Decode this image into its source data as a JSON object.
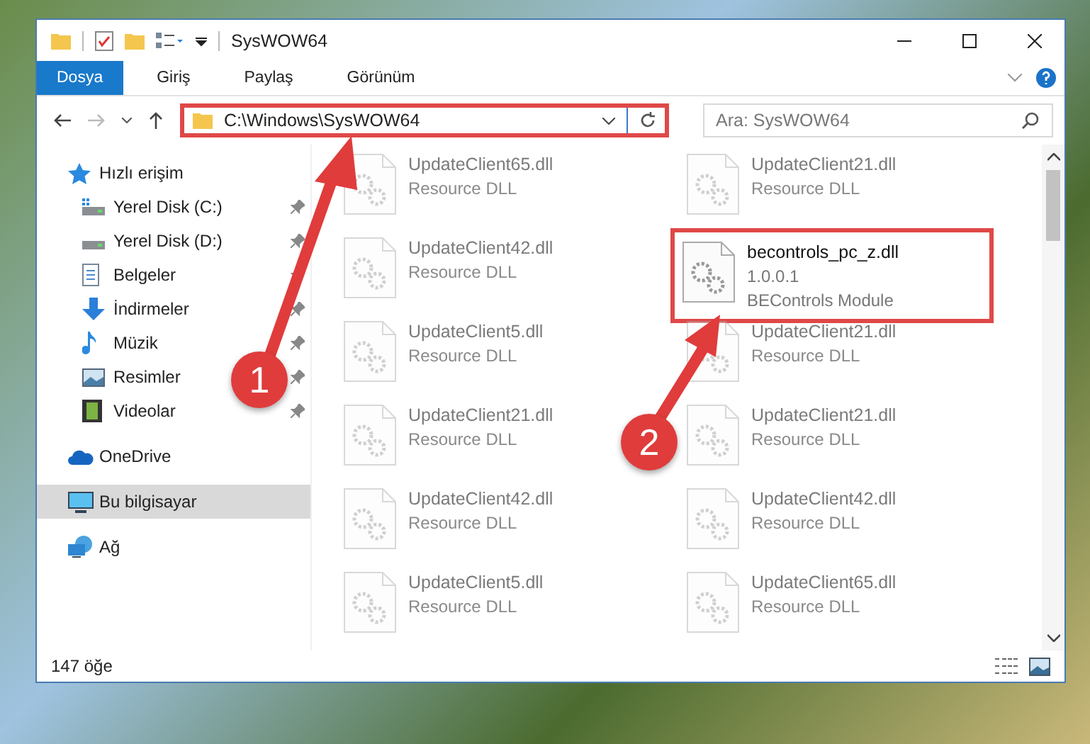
{
  "window": {
    "title": "SysWOW64"
  },
  "ribbon_tabs": [
    {
      "label": "Dosya",
      "selected": true
    },
    {
      "label": "Giriş",
      "selected": false
    },
    {
      "label": "Paylaş",
      "selected": false
    },
    {
      "label": "Görünüm",
      "selected": false
    }
  ],
  "address_bar": {
    "path": "C:\\Windows\\SysWOW64",
    "highlighted": true
  },
  "search": {
    "placeholder": "Ara: SysWOW64"
  },
  "sidebar": {
    "items": [
      {
        "label": "Hızlı erişim",
        "kind": "star",
        "selected": false,
        "children": [
          {
            "label": "Yerel Disk (C:)",
            "kind": "drive-c",
            "pinned": true,
            "selected": false
          },
          {
            "label": "Yerel Disk (D:)",
            "kind": "drive",
            "pinned": true,
            "selected": false
          },
          {
            "label": "Belgeler",
            "kind": "doc",
            "pinned": true,
            "selected": false
          },
          {
            "label": "İndirmeler",
            "kind": "download",
            "pinned": true,
            "selected": false
          },
          {
            "label": "Müzik",
            "kind": "music",
            "pinned": true,
            "selected": false
          },
          {
            "label": "Resimler",
            "kind": "picture",
            "pinned": true,
            "selected": false
          },
          {
            "label": "Videolar",
            "kind": "film",
            "pinned": true,
            "selected": false
          }
        ]
      },
      {
        "label": "OneDrive",
        "kind": "cloud",
        "selected": false
      },
      {
        "label": "Bu bilgisayar",
        "kind": "pc",
        "selected": true
      },
      {
        "label": "Ağ",
        "kind": "network",
        "selected": false
      }
    ]
  },
  "files": [
    {
      "name": "UpdateClient65.dll",
      "description": "Resource DLL",
      "highlighted": false
    },
    {
      "name": "UpdateClient21.dll",
      "description": "Resource DLL",
      "highlighted": false
    },
    {
      "name": "UpdateClient42.dll",
      "description": "Resource DLL",
      "highlighted": false
    },
    {
      "name": "becontrols_pc_z.dll",
      "version": "1.0.0.1",
      "description": "BEControls Module",
      "highlighted": true
    },
    {
      "name": "UpdateClient5.dll",
      "description": "Resource DLL",
      "highlighted": false
    },
    {
      "name": "UpdateClient21.dll",
      "description": "Resource DLL",
      "highlighted": false
    },
    {
      "name": "UpdateClient21.dll",
      "description": "Resource DLL",
      "highlighted": false
    },
    {
      "name": "UpdateClient21.dll",
      "description": "Resource DLL",
      "highlighted": false
    },
    {
      "name": "UpdateClient42.dll",
      "description": "Resource DLL",
      "highlighted": false
    },
    {
      "name": "UpdateClient42.dll",
      "description": "Resource DLL",
      "highlighted": false
    },
    {
      "name": "UpdateClient5.dll",
      "description": "Resource DLL",
      "highlighted": false
    },
    {
      "name": "UpdateClient65.dll",
      "description": "Resource DLL",
      "highlighted": false
    }
  ],
  "status_bar": {
    "count": "147 öğe"
  },
  "annotations": [
    {
      "label": "1"
    },
    {
      "label": "2"
    }
  ]
}
